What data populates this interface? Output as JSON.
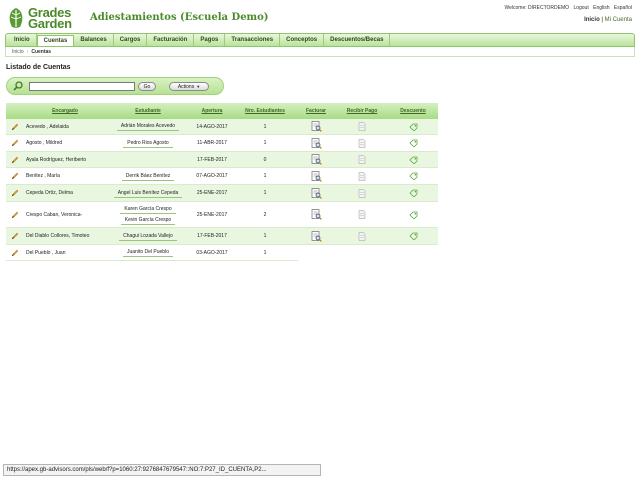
{
  "brand": {
    "line1": "Grades",
    "line2": "Garden"
  },
  "app_title": "Adiestamientos (Escuela Demo)",
  "top_links": {
    "welcome": "Welcome: DIRECTORDEMO",
    "logout": "Logout",
    "english": "English",
    "espanol": "Español"
  },
  "top_nav": {
    "inicio": "Inicio",
    "separator": "|",
    "mi_cuenta": "Mi Cuenta"
  },
  "tabs": [
    {
      "label": "Inicio"
    },
    {
      "label": "Cuentas"
    },
    {
      "label": "Balances"
    },
    {
      "label": "Cargos"
    },
    {
      "label": "Facturación"
    },
    {
      "label": "Pagos"
    },
    {
      "label": "Transacciones"
    },
    {
      "label": "Conceptos"
    },
    {
      "label": "Descuentos/Becas"
    }
  ],
  "active_tab": "Cuentas",
  "breadcrumb": {
    "home": "Inicio",
    "separator": "›",
    "current": "Cuentas"
  },
  "page_title": "Listado de Cuentas",
  "search": {
    "value": "",
    "go_label": "Go",
    "actions_label": "Actions"
  },
  "columns": {
    "encargado": "Encargado",
    "estudiante": "Estudiante",
    "apertura": "Apertura",
    "nro": "Nro. Estudiantes",
    "facturar": "Facturar",
    "recibir": "Recibir Pago",
    "descuento": "Descuento"
  },
  "rows": [
    {
      "encargado": "Acevedo , Adelaida",
      "estudiantes": [
        "Adrián Morales Acevedo"
      ],
      "apertura": "14-AGO-2017",
      "nro": "1"
    },
    {
      "encargado": "Agosto , Mildred",
      "estudiantes": [
        "Pedro Rios Agosto"
      ],
      "apertura": "11-ABR-2017",
      "nro": "1"
    },
    {
      "encargado": "Ayala Rodríguez, Heriberto",
      "estudiantes": [],
      "apertura": "17-FEB-2017",
      "nro": "0"
    },
    {
      "encargado": "Benítez , María",
      "estudiantes": [
        "Derrik Báez Benítez"
      ],
      "apertura": "07-AGO-2017",
      "nro": "1"
    },
    {
      "encargado": "Cepeda Ortíz, Delma",
      "estudiantes": [
        "Angel Luis Benítez Cepeda"
      ],
      "apertura": "25-ENE-2017",
      "nro": "1"
    },
    {
      "encargado": "Crespo Caban, Veronica-",
      "estudiantes": [
        "Karen García Crespo",
        "Kevin García Crespo"
      ],
      "apertura": "25-ENE-2017",
      "nro": "2"
    },
    {
      "encargado": "Del Diablo Collores, Timoteo",
      "estudiantes": [
        "Chagui Lozada Vallejo"
      ],
      "apertura": "17-FEB-2017",
      "nro": "1"
    },
    {
      "encargado": "Del Pueblo , Juan",
      "estudiantes": [
        "Juanito Del Pueblo"
      ],
      "apertura": "03-AGO-2017",
      "nro": "1"
    }
  ],
  "status_url": "https://apex.gb-advisors.com/pls/web/f?p=1060:27:9276847679547::NO:7:P27_ID_CUENTA,P2...",
  "colors": {
    "brand_green": "#4a8a2a",
    "tab_green": "#b9e39c",
    "row_alt": "#eaf7e0"
  },
  "icons": {
    "edit": "pencil-icon",
    "invoice": "invoice-search-icon",
    "receipt": "document-icon",
    "discount": "discount-tag-icon",
    "search": "magnifier-icon"
  }
}
